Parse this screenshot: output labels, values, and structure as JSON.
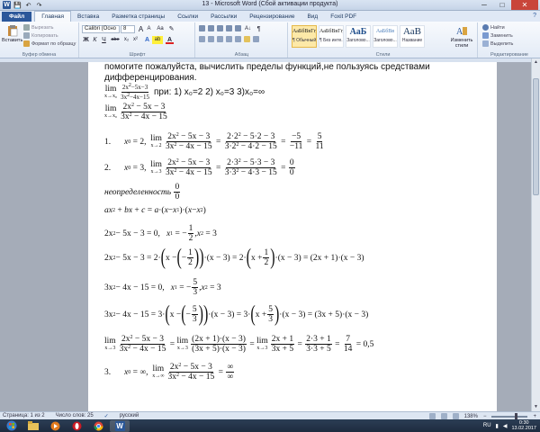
{
  "window": {
    "title": "13 - Microsoft Word (Сбой активации продукта)",
    "minimize_glyph": "─",
    "maximize_glyph": "□",
    "close_glyph": "✕"
  },
  "quick_access": {
    "word_icon": "W",
    "save_glyph": "💾",
    "undo_glyph": "↶",
    "redo_glyph": "↷"
  },
  "ribbon_tabs": [
    "Файл",
    "Главная",
    "Вставка",
    "Разметка страницы",
    "Ссылки",
    "Рассылки",
    "Рецензирование",
    "Вид",
    "Foxit PDF"
  ],
  "active_tab": "Главная",
  "help_glyph": "?",
  "ribbon": {
    "clipboard": {
      "label": "Буфер обмена",
      "paste": "Вставить",
      "cut": "Вырезать",
      "copy": "Копировать",
      "format_painter": "Формат по образцу"
    },
    "font": {
      "label": "Шрифт",
      "font_name": "Calibri (Осно",
      "font_size": "8",
      "grow": "A",
      "shrink": "A",
      "case": "Aa",
      "clear": "✎",
      "bold": "Ж",
      "italic": "К",
      "underline": "Ч",
      "strike": "abe",
      "subscript": "x₂",
      "superscript": "x²",
      "effects": "A",
      "highlight": "ab",
      "color": "A"
    },
    "paragraph": {
      "label": "Абзац",
      "sort": "А↓",
      "pilcrow": "¶"
    },
    "styles": {
      "label": "Стили",
      "items": [
        {
          "sample": "АаБбВвГг,",
          "name": "¶ Обычный",
          "selected": true
        },
        {
          "sample": "АаБбВвГг,",
          "name": "¶ Без инте...",
          "selected": false
        },
        {
          "sample": "АаБ",
          "name": "Заголово...",
          "selected": false
        },
        {
          "sample": "АаБбВв",
          "name": "Заголово...",
          "selected": false
        },
        {
          "sample": "АаВ",
          "name": "Название",
          "selected": false
        }
      ],
      "change_styles": "Изменить стили"
    },
    "editing": {
      "label": "Редактирование",
      "find": "Найти",
      "replace": "Заменить",
      "select": "Выделить"
    }
  },
  "document": {
    "question": "помогите пожалуйста, вычислить пределы функций,не пользуясь средствами дифференцирования.",
    "task_suffix": "при: 1) x₀=2 2) x₀=3 3)x₀=∞",
    "indeterminate": "неопределенность"
  },
  "statusbar": {
    "page": "Страница: 1 из 2",
    "words": "Число слов: 25",
    "language": "русский",
    "zoom": "138%",
    "zoom_minus": "−",
    "zoom_plus": "+"
  },
  "taskbar": {
    "lang": "RU",
    "time": "0:30",
    "date": "13.02.2017",
    "word_icon": "W"
  }
}
